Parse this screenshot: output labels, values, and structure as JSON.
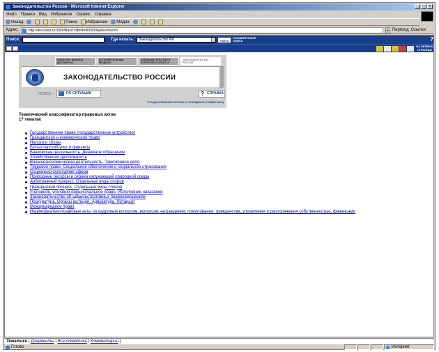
{
  "window": {
    "title": "Законодательство России - Microsoft Internet Explorer"
  },
  "menu": [
    "Файл",
    "Правка",
    "Вид",
    "Избранное",
    "Сервис",
    "Справка"
  ],
  "toolbar": {
    "back": "Назад",
    "search": "Поиск",
    "favorites": "Избранное",
    "media": "Медиа"
  },
  "address": {
    "label": "Адрес:",
    "url": "http://dev.tusur.ru:3000/Basic?dbrId=900000&prev=0oc=3",
    "go": "Переход",
    "links": "Ссылки"
  },
  "search": {
    "label": "Поиск:",
    "where_label": "Где искать:",
    "where_value": "Законодательство РФ",
    "find": "Найти",
    "advanced": "РАСШИРЕННЫЙ ПОИСК"
  },
  "first_page": "НА ПЕРВУЮ СТРАНИЦУ",
  "banner": {
    "tabs": [
      "НАИБОЛЕЕ ВАЖНЫЕ ДОКУМЕНТЫ",
      "ДОПОЛНИТЕЛЬНЫЕ РАЗДЕЛЫ",
      "ЗАКОНОДАТЕЛЬСТВО В ВОПРОСАХ И ОТВЕТАХ",
      "ЗАКОНОДАТЕЛЬСТВО РОССИИ"
    ],
    "title": "ЗАКОНОДАТЕЛЬСТВО РОССИИ",
    "search_label": "ПОИСК:",
    "situation": "ПО СИТУАЦИИ",
    "help": "СПРАВКА",
    "orgs": "ГОСУДАРСТВЕННЫЕ ОРГАНЫ И УЧРЕЖДЕНИЯ (СПРАВОЧНИК)"
  },
  "page": {
    "heading": "Тематический классификатор правовых актов",
    "count": "17 тематик"
  },
  "topics": [
    "Государственное право (государственное устройство)",
    "Гражданское и коммерческое право",
    "Налоги и сборы",
    "Бухгалтерский учет и финансы",
    "Банковская деятельность. Денежное обращение",
    "Хозяйственная деятельность",
    "Внешнеэкономическая деятельность. Таможенное дело",
    "Трудовое право. Социальное обеспечение и социальное страхование",
    "Социально-культурная сфера",
    "Природные ресурсы и охрана окружающей природной среды",
    "Арбитражный процесс. Отдельные виды споров",
    "Гражданский процесс. Отдельные виды споров",
    "Уголовное, уголовно-процессуальное право. Исполнение наказаний",
    "Законодательство об административных правонарушениях",
    "Прокуратура. Органы юстиции. Адвокатура. Нотариат",
    "Международное право",
    "Индивидуально-правовые акты по кадровым вопросам, вопросам награждения, помилования, гражданства, управления и распоряжения собственностью, финансами"
  ],
  "bottom_tabs": {
    "current": "Тематики",
    "docs": "Документы",
    "all": "Все тематики",
    "comments": "Комментарии"
  },
  "status": {
    "text": "Готово",
    "zone": "Интернет"
  }
}
